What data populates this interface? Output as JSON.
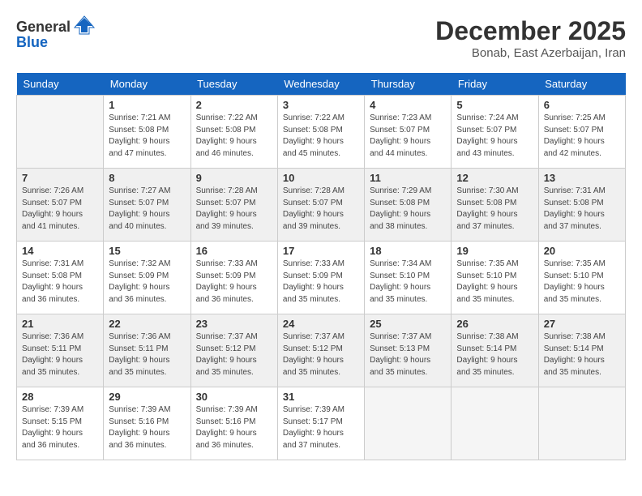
{
  "logo": {
    "text_general": "General",
    "text_blue": "Blue"
  },
  "title": "December 2025",
  "subtitle": "Bonab, East Azerbaijan, Iran",
  "days_of_week": [
    "Sunday",
    "Monday",
    "Tuesday",
    "Wednesday",
    "Thursday",
    "Friday",
    "Saturday"
  ],
  "weeks": [
    [
      {
        "day": "",
        "empty": true
      },
      {
        "day": "1",
        "sunrise": "Sunrise: 7:21 AM",
        "sunset": "Sunset: 5:08 PM",
        "daylight": "Daylight: 9 hours and 47 minutes."
      },
      {
        "day": "2",
        "sunrise": "Sunrise: 7:22 AM",
        "sunset": "Sunset: 5:08 PM",
        "daylight": "Daylight: 9 hours and 46 minutes."
      },
      {
        "day": "3",
        "sunrise": "Sunrise: 7:22 AM",
        "sunset": "Sunset: 5:08 PM",
        "daylight": "Daylight: 9 hours and 45 minutes."
      },
      {
        "day": "4",
        "sunrise": "Sunrise: 7:23 AM",
        "sunset": "Sunset: 5:07 PM",
        "daylight": "Daylight: 9 hours and 44 minutes."
      },
      {
        "day": "5",
        "sunrise": "Sunrise: 7:24 AM",
        "sunset": "Sunset: 5:07 PM",
        "daylight": "Daylight: 9 hours and 43 minutes."
      },
      {
        "day": "6",
        "sunrise": "Sunrise: 7:25 AM",
        "sunset": "Sunset: 5:07 PM",
        "daylight": "Daylight: 9 hours and 42 minutes."
      }
    ],
    [
      {
        "day": "7",
        "sunrise": "Sunrise: 7:26 AM",
        "sunset": "Sunset: 5:07 PM",
        "daylight": "Daylight: 9 hours and 41 minutes."
      },
      {
        "day": "8",
        "sunrise": "Sunrise: 7:27 AM",
        "sunset": "Sunset: 5:07 PM",
        "daylight": "Daylight: 9 hours and 40 minutes."
      },
      {
        "day": "9",
        "sunrise": "Sunrise: 7:28 AM",
        "sunset": "Sunset: 5:07 PM",
        "daylight": "Daylight: 9 hours and 39 minutes."
      },
      {
        "day": "10",
        "sunrise": "Sunrise: 7:28 AM",
        "sunset": "Sunset: 5:07 PM",
        "daylight": "Daylight: 9 hours and 39 minutes."
      },
      {
        "day": "11",
        "sunrise": "Sunrise: 7:29 AM",
        "sunset": "Sunset: 5:08 PM",
        "daylight": "Daylight: 9 hours and 38 minutes."
      },
      {
        "day": "12",
        "sunrise": "Sunrise: 7:30 AM",
        "sunset": "Sunset: 5:08 PM",
        "daylight": "Daylight: 9 hours and 37 minutes."
      },
      {
        "day": "13",
        "sunrise": "Sunrise: 7:31 AM",
        "sunset": "Sunset: 5:08 PM",
        "daylight": "Daylight: 9 hours and 37 minutes."
      }
    ],
    [
      {
        "day": "14",
        "sunrise": "Sunrise: 7:31 AM",
        "sunset": "Sunset: 5:08 PM",
        "daylight": "Daylight: 9 hours and 36 minutes."
      },
      {
        "day": "15",
        "sunrise": "Sunrise: 7:32 AM",
        "sunset": "Sunset: 5:09 PM",
        "daylight": "Daylight: 9 hours and 36 minutes."
      },
      {
        "day": "16",
        "sunrise": "Sunrise: 7:33 AM",
        "sunset": "Sunset: 5:09 PM",
        "daylight": "Daylight: 9 hours and 36 minutes."
      },
      {
        "day": "17",
        "sunrise": "Sunrise: 7:33 AM",
        "sunset": "Sunset: 5:09 PM",
        "daylight": "Daylight: 9 hours and 35 minutes."
      },
      {
        "day": "18",
        "sunrise": "Sunrise: 7:34 AM",
        "sunset": "Sunset: 5:10 PM",
        "daylight": "Daylight: 9 hours and 35 minutes."
      },
      {
        "day": "19",
        "sunrise": "Sunrise: 7:35 AM",
        "sunset": "Sunset: 5:10 PM",
        "daylight": "Daylight: 9 hours and 35 minutes."
      },
      {
        "day": "20",
        "sunrise": "Sunrise: 7:35 AM",
        "sunset": "Sunset: 5:10 PM",
        "daylight": "Daylight: 9 hours and 35 minutes."
      }
    ],
    [
      {
        "day": "21",
        "sunrise": "Sunrise: 7:36 AM",
        "sunset": "Sunset: 5:11 PM",
        "daylight": "Daylight: 9 hours and 35 minutes."
      },
      {
        "day": "22",
        "sunrise": "Sunrise: 7:36 AM",
        "sunset": "Sunset: 5:11 PM",
        "daylight": "Daylight: 9 hours and 35 minutes."
      },
      {
        "day": "23",
        "sunrise": "Sunrise: 7:37 AM",
        "sunset": "Sunset: 5:12 PM",
        "daylight": "Daylight: 9 hours and 35 minutes."
      },
      {
        "day": "24",
        "sunrise": "Sunrise: 7:37 AM",
        "sunset": "Sunset: 5:12 PM",
        "daylight": "Daylight: 9 hours and 35 minutes."
      },
      {
        "day": "25",
        "sunrise": "Sunrise: 7:37 AM",
        "sunset": "Sunset: 5:13 PM",
        "daylight": "Daylight: 9 hours and 35 minutes."
      },
      {
        "day": "26",
        "sunrise": "Sunrise: 7:38 AM",
        "sunset": "Sunset: 5:14 PM",
        "daylight": "Daylight: 9 hours and 35 minutes."
      },
      {
        "day": "27",
        "sunrise": "Sunrise: 7:38 AM",
        "sunset": "Sunset: 5:14 PM",
        "daylight": "Daylight: 9 hours and 35 minutes."
      }
    ],
    [
      {
        "day": "28",
        "sunrise": "Sunrise: 7:39 AM",
        "sunset": "Sunset: 5:15 PM",
        "daylight": "Daylight: 9 hours and 36 minutes."
      },
      {
        "day": "29",
        "sunrise": "Sunrise: 7:39 AM",
        "sunset": "Sunset: 5:16 PM",
        "daylight": "Daylight: 9 hours and 36 minutes."
      },
      {
        "day": "30",
        "sunrise": "Sunrise: 7:39 AM",
        "sunset": "Sunset: 5:16 PM",
        "daylight": "Daylight: 9 hours and 36 minutes."
      },
      {
        "day": "31",
        "sunrise": "Sunrise: 7:39 AM",
        "sunset": "Sunset: 5:17 PM",
        "daylight": "Daylight: 9 hours and 37 minutes."
      },
      {
        "day": "",
        "empty": true
      },
      {
        "day": "",
        "empty": true
      },
      {
        "day": "",
        "empty": true
      }
    ]
  ]
}
